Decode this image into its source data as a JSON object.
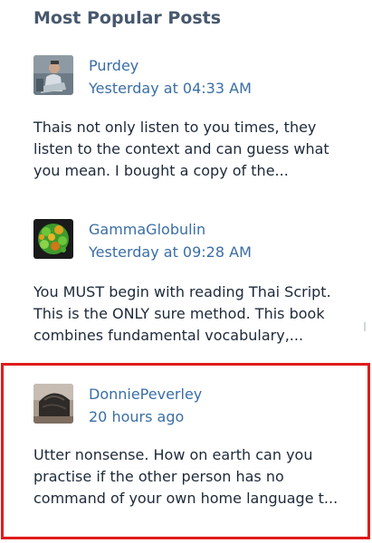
{
  "widget": {
    "title": "Most Popular Posts"
  },
  "posts": [
    {
      "author": "Purdey",
      "time": "Yesterday at 04:33 AM",
      "excerpt_lines": [
        "Thais not only listen to you times, they",
        "listen to the context and can guess what",
        "you mean. I bought a copy of the..."
      ]
    },
    {
      "author": "GammaGlobulin",
      "time": "Yesterday at 09:28 AM",
      "excerpt_lines": [
        "You MUST begin with reading Thai Script.",
        "This is the ONLY sure method. This book",
        "combines fundamental vocabulary,..."
      ]
    },
    {
      "author": "DonniePeverley",
      "time": "20 hours ago",
      "excerpt_lines": [
        "Utter nonsense. How on earth can you",
        "practise if the other person has no",
        "command of your own home language t..."
      ]
    }
  ],
  "colors": {
    "title": "#47586d",
    "link": "#3a6ea5",
    "text": "#1d2939",
    "highlight_border": "#e01b1b"
  }
}
